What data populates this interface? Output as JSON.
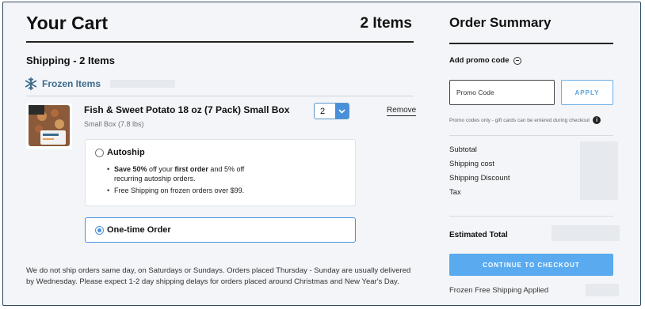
{
  "cart": {
    "title": "Your Cart",
    "item_count": "2 Items"
  },
  "shipping": {
    "heading": "Shipping - 2 Items",
    "group_label": "Frozen Items",
    "group_icon": "snowflake-icon"
  },
  "product": {
    "name": "Fish & Sweet Potato 18 oz (7 Pack) Small Box",
    "size": "Small Box (7.8 lbs)",
    "quantity": "2",
    "remove_label": "Remove"
  },
  "purchase_options": {
    "autoship": {
      "label": "Autoship",
      "selected": false,
      "benefit_1_prefix": "Save 50%",
      "benefit_1_mid": " off your ",
      "benefit_1_emph": "first order",
      "benefit_1_suffix": " and 5% off recurring autoship orders.",
      "benefit_2": "Free Shipping on frozen orders over $99."
    },
    "one_time": {
      "label": "One-time Order",
      "selected": true
    }
  },
  "notice": "We do not ship orders same day, on Saturdays or Sundays. Orders placed Thursday - Sunday are usually delivered by Wednesday. Please expect 1-2 day shipping delays for orders placed around Christmas and New Year's Day.",
  "summary": {
    "title": "Order Summary",
    "promo_heading": "Add promo code",
    "promo_placeholder": "Promo Code",
    "apply_label": "APPLY",
    "promo_note": "Promo codes only - gift cards can be entered during checkout",
    "lines": [
      "Subtotal",
      "Shipping cost",
      "Shipping Discount",
      "Tax"
    ],
    "estimated_total_label": "Estimated Total",
    "checkout_label": "CONTINUE TO CHECKOUT",
    "free_shipping_note": "Frozen Free Shipping Applied"
  },
  "colors": {
    "accent": "#4a90d9",
    "checkout": "#5aaaf0",
    "frozen_label": "#3c6a8c",
    "page_bg": "#f3f5f8",
    "border": "#2f4a63"
  }
}
